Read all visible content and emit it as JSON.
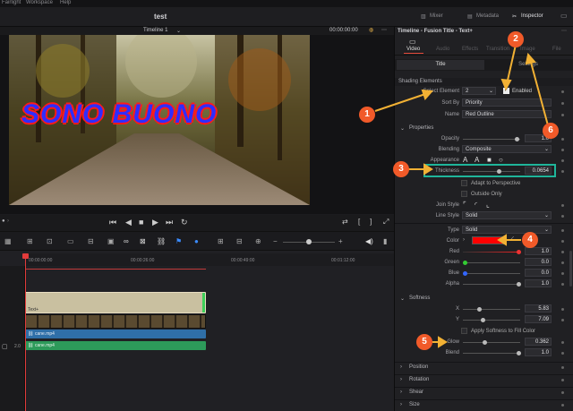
{
  "menubar": {
    "items": [
      "Fairlight",
      "Workspace",
      "Help"
    ]
  },
  "window": {
    "project_title": "test"
  },
  "toolbar_right": {
    "mixer": "Mixer",
    "metadata": "Metadata",
    "inspector": "Inspector"
  },
  "viewer": {
    "timeline_name": "Timeline 1",
    "timecode": "00:00:00:00",
    "overlay_text": "SONO BUONO"
  },
  "inspector": {
    "header": "Timeline - Fusion Title - Text+",
    "tabs": [
      "Video",
      "Audio",
      "Effects",
      "Transition",
      "Image",
      "File"
    ],
    "subtabs": [
      "Title",
      "Settings"
    ],
    "shading": {
      "section": "Shading Elements",
      "select_element_label": "Select Element",
      "select_element_value": "2",
      "enabled_label": "Enabled",
      "sort_by_label": "Sort By",
      "sort_by_value": "Priority",
      "name_label": "Name",
      "name_value": "Red Outline"
    },
    "properties": {
      "section": "Properties",
      "opacity_label": "Opacity",
      "opacity_value": "1.0",
      "blending_label": "Blending",
      "blending_value": "Composite",
      "appearance_label": "Appearance",
      "thickness_label": "Thickness",
      "thickness_value": "0.0654",
      "adapt_label": "Adapt to Perspective",
      "outside_label": "Outside Only",
      "join_label": "Join Style",
      "line_style_label": "Line Style",
      "line_style_value": "Solid",
      "type_label": "Type",
      "type_value": "Solid",
      "color_label": "Color",
      "color_swatch": "#ff0000",
      "red_label": "Red",
      "red_value": "1.0",
      "green_label": "Green",
      "green_value": "0.0",
      "blue_label": "Blue",
      "blue_value": "0.0",
      "alpha_label": "Alpha",
      "alpha_value": "1.0"
    },
    "softness": {
      "section": "Softness",
      "x_label": "X",
      "x_value": "5.83",
      "y_label": "Y",
      "y_value": "7.09",
      "apply_label": "Apply Softness to Fill Color",
      "glow_label": "Glow",
      "glow_value": "0.362",
      "blend_label": "Blend",
      "blend_value": "1.0"
    },
    "collapsed_sections": [
      "Position",
      "Rotation",
      "Shear",
      "Size"
    ]
  },
  "timeline": {
    "ruler": [
      "00:00:00:00",
      "00:00:26:00",
      "00:00:49:00",
      "00:01:12:00"
    ],
    "title_clip": "Text+",
    "video_clip": "cane.mp4",
    "audio_clip": "cane.mp4",
    "audio_track_number": "2.0"
  },
  "callouts": [
    "1",
    "2",
    "3",
    "4",
    "5",
    "6"
  ],
  "colors": {
    "accent_red": "#e64b3b",
    "callout": "#f15a29",
    "highlight_box": "#1fb59a",
    "playhead": "#e23b3b",
    "title_clip": "#c9c0a0",
    "video_clip": "#2f6fa8",
    "audio_clip": "#2d9a5a"
  }
}
